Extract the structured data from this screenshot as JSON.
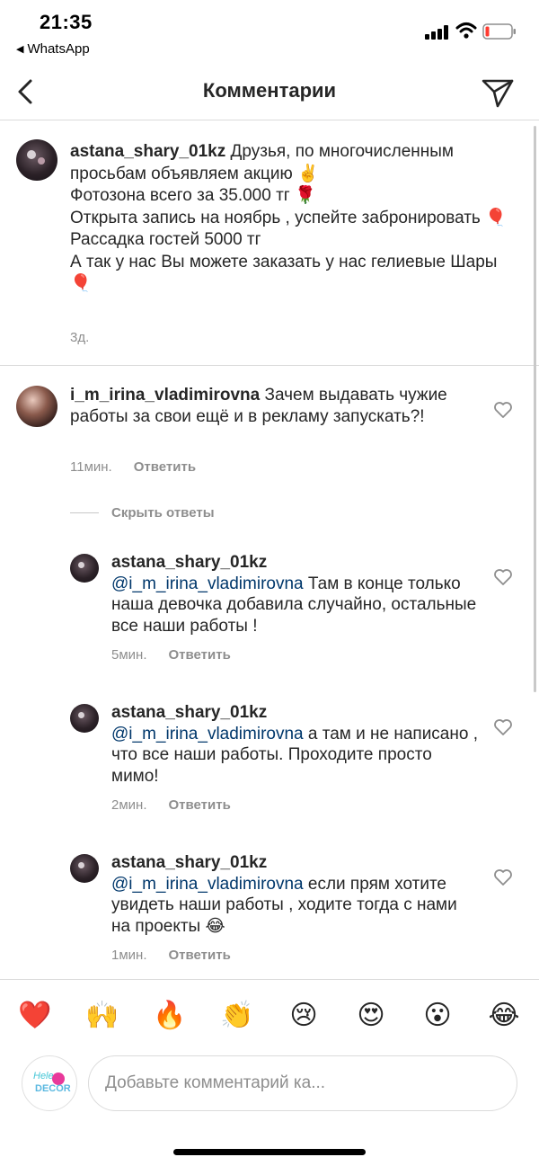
{
  "status_bar": {
    "time": "21:35",
    "back_app": "WhatsApp",
    "icons": [
      "signal-icon",
      "wifi-icon",
      "battery-low-icon"
    ]
  },
  "nav": {
    "title": "Комментарии",
    "back_icon": "chevron-left-icon",
    "share_icon": "paper-plane-icon"
  },
  "caption": {
    "username": "astana_shary_01kz",
    "lines": [
      "Друзья, по многочисленным просьбам объявляем акцию ✌️",
      "Фотозона всего за 35.000 тг 🌹",
      "Открыта запись на ноябрь , успейте забронировать 🎈",
      "Рассадка гостей 5000 тг",
      "А так у нас Вы можете заказать у нас гелиевые Шары 🎈"
    ],
    "time": "3д."
  },
  "comments": [
    {
      "username": "i_m_irina_vladimirovna",
      "mention": "",
      "text": "Зачем выдавать чужие работы за свои ещё и в рекламу запускать?!",
      "time": "11мин.",
      "reply_label": "Ответить"
    }
  ],
  "hide_replies_label": "Скрыть ответы",
  "replies": [
    {
      "username": "astana_shary_01kz",
      "mention": "@i_m_irina_vladimirovna",
      "text": "Там в конце только наша девочка добавила случайно, остальные все наши работы !",
      "time": "5мин.",
      "reply_label": "Ответить"
    },
    {
      "username": "astana_shary_01kz",
      "mention": "@i_m_irina_vladimirovna",
      "text": "а там и не написано , что все наши работы. Проходите просто мимо!",
      "time": "2мин.",
      "reply_label": "Ответить"
    },
    {
      "username": "astana_shary_01kz",
      "mention": "@i_m_irina_vladimirovna",
      "text": "если прям хотите увидеть наши работы , ходите тогда с нами на проекты 😂",
      "time": "1мин.",
      "reply_label": "Ответить"
    }
  ],
  "emoji_bar": [
    "❤️",
    "🙌",
    "🔥",
    "👏",
    "😢",
    "😍",
    "😮",
    "😂"
  ],
  "composer": {
    "placeholder": "Добавьте комментарий ка...",
    "avatar_logo_top": "Hele",
    "avatar_logo_bottom": "DECOR"
  },
  "colors": {
    "text": "#262626",
    "secondary": "#8e8e8e",
    "mention": "#00376b",
    "divider": "#dbdbdb",
    "battery_low": "#ff3b30"
  }
}
